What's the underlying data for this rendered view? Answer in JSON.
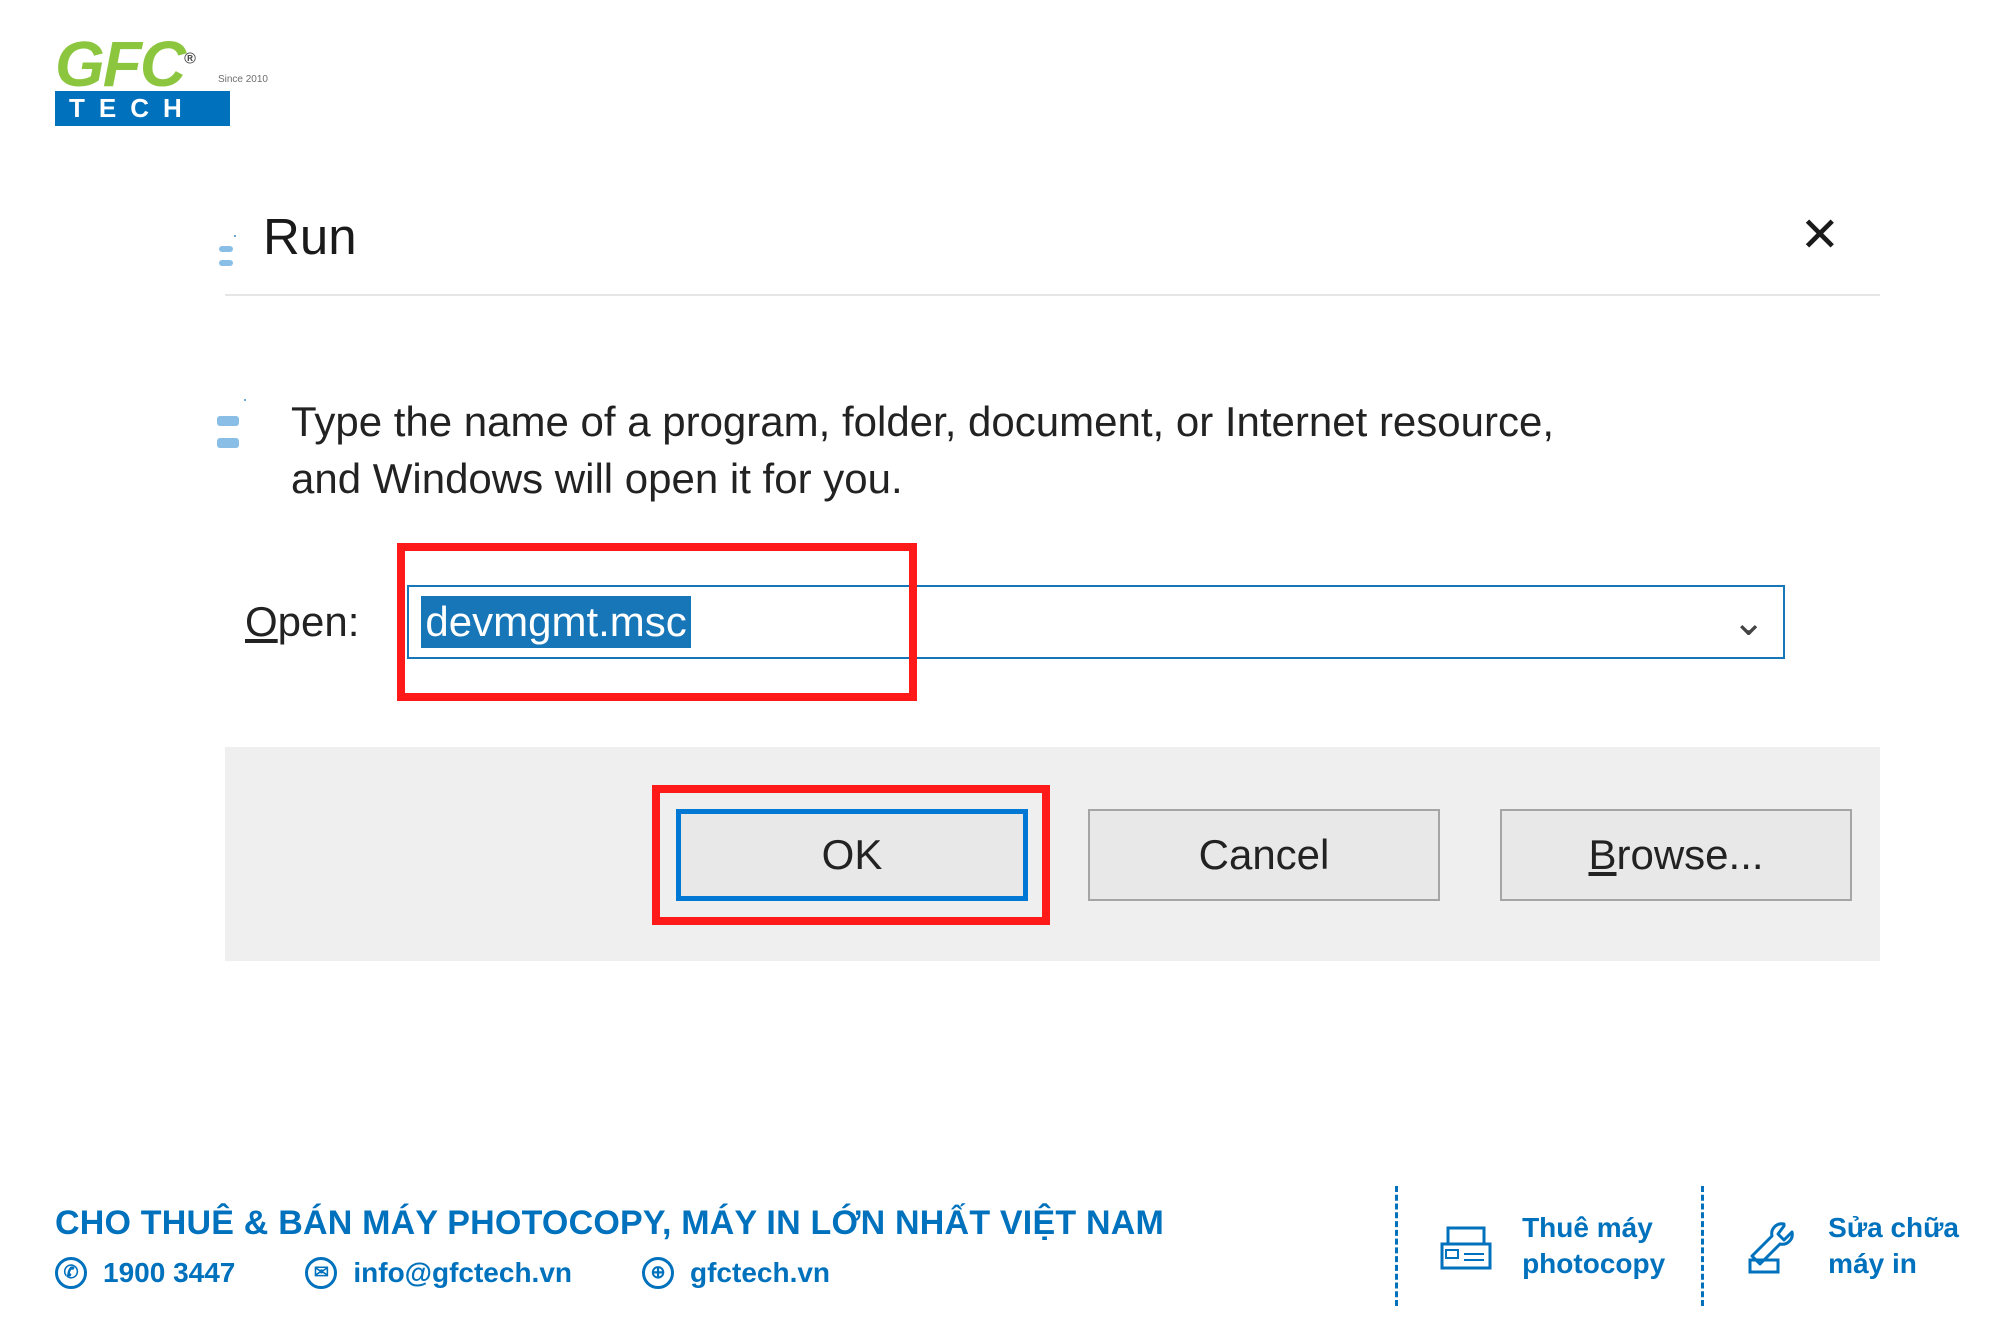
{
  "logo": {
    "top": "GFC",
    "sub": "TECH",
    "tag": "Since 2010",
    "reg": "®"
  },
  "dialog": {
    "title": "Run",
    "instruction": "Type the name of a program, folder, document, or Internet resource, and Windows will open it for you.",
    "open_prefix": "O",
    "open_rest": "pen:",
    "value": "devmgmt.msc",
    "dropdown_glyph": "⌄",
    "close_glyph": "✕",
    "ok": "OK",
    "cancel": "Cancel",
    "browse_prefix": "B",
    "browse_rest": "rowse..."
  },
  "infobar": {
    "headline": "CHO THUÊ & BÁN MÁY PHOTOCOPY, MÁY IN LỚN NHẤT VIỆT NAM",
    "phone": "1900 3447",
    "email": "info@gfctech.vn",
    "site": "gfctech.vn",
    "svc1_l1": "Thuê máy",
    "svc1_l2": "photocopy",
    "svc2_l1": "Sửa chữa",
    "svc2_l2": "máy in"
  }
}
